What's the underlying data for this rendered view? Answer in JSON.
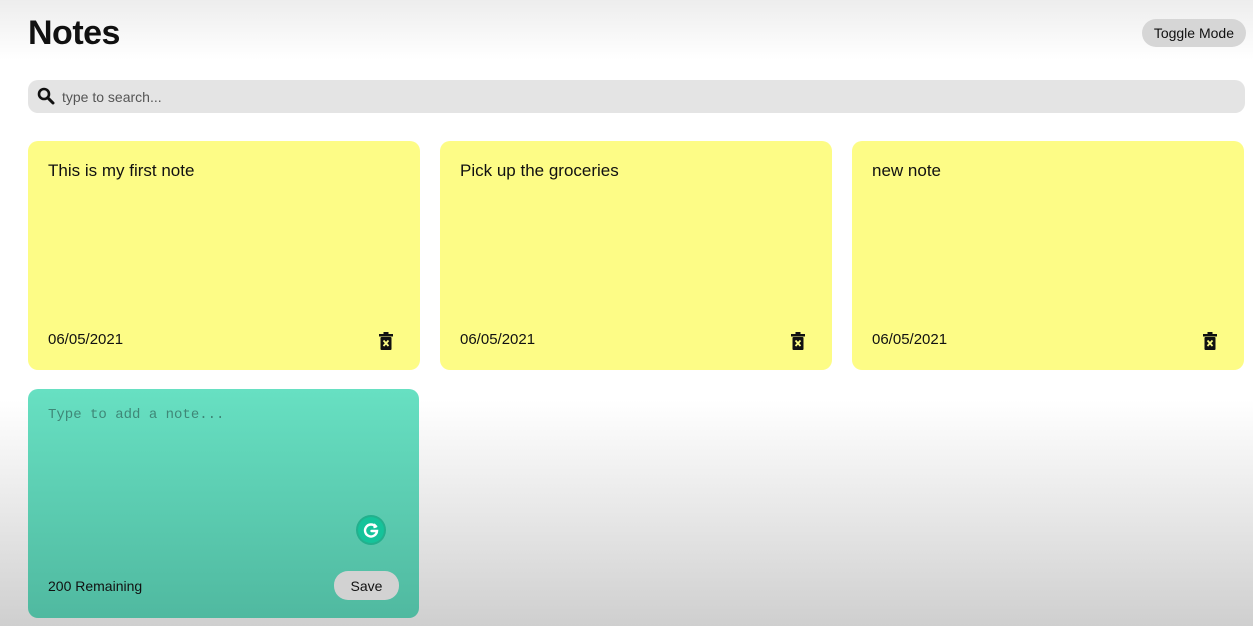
{
  "header": {
    "title": "Notes",
    "toggle_label": "Toggle Mode"
  },
  "search": {
    "placeholder": "type to search...",
    "icon": "search-icon"
  },
  "notes": [
    {
      "text": "This is my first note",
      "date": "06/05/2021",
      "delete_icon": "trash-icon"
    },
    {
      "text": "Pick up the groceries",
      "date": "06/05/2021",
      "delete_icon": "trash-icon"
    },
    {
      "text": "new note",
      "date": "06/05/2021",
      "delete_icon": "trash-icon"
    }
  ],
  "new_note": {
    "placeholder": "Type to add a note...",
    "remaining": "200 Remaining",
    "save_label": "Save",
    "extension_icon": "grammarly-icon"
  },
  "colors": {
    "note_background": "#fdfc86",
    "new_note_background_top": "#67e0c2",
    "new_note_background_bottom": "#50b9a0",
    "search_background": "#e4e4e4",
    "button_background": "#d6d6d6"
  }
}
